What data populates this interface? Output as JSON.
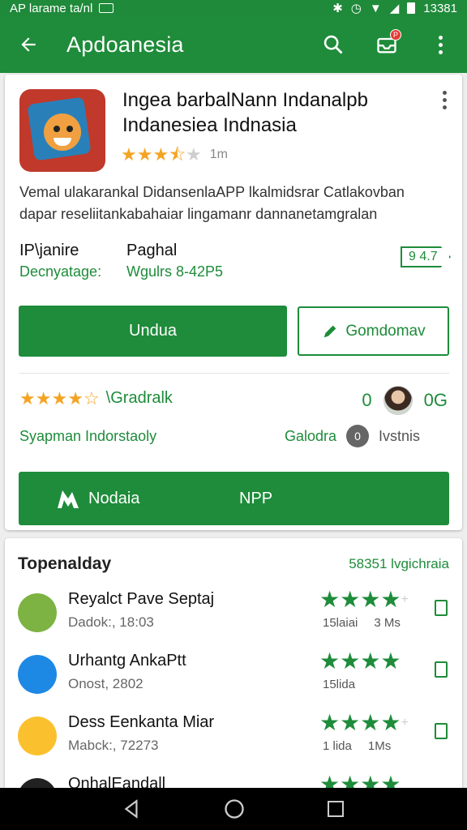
{
  "status_bar": {
    "left_text": "AP larame ta/nl",
    "time": "13381"
  },
  "app_bar": {
    "title": "Apdoanesia",
    "notif_count": "P"
  },
  "app": {
    "title_line1": "Ingea barbalNann Indanalpb",
    "title_line2": "Indanesiea Indnasia",
    "rating": 3.5,
    "rating_count": "1m",
    "description_line1": "Vemal ulakarankal DidansenlaAPP lkalmidsrar Catlakovban",
    "description_line2": "dapar reseliitankabahaiar lingamanr dannanetamgralan",
    "meta1_key": "IP\\janire",
    "meta1_value": "Decnyatage:",
    "meta2_key": "Paghal",
    "meta2_value": "Wgulrs 8-42P5",
    "tag": "9 4.7"
  },
  "buttons": {
    "install": "Undua",
    "secondary": "Gomdomav",
    "wide_left": "Nodaia",
    "wide_right": "NPP"
  },
  "sub_rating": {
    "stars": 4.5,
    "label": "\\Gradralk",
    "right_a": "0",
    "right_b": "0G"
  },
  "developer": {
    "left": "Syapman Indorstaoly",
    "right_green": "Galodra",
    "right_icon": "0",
    "right_gray": "Ivstnis"
  },
  "list": {
    "heading": "Topenalday",
    "more": "58351 lvgichraia",
    "rows": [
      {
        "name": "Reyalct Pave Septaj",
        "sub": "Dadok:, 18:03",
        "stat1": "15laiai",
        "stat2": "3 Ms",
        "icon_color": "#7cb342"
      },
      {
        "name": "Urhantg AnkaPtt",
        "sub": "Onost, 2802",
        "stat1": "15lida",
        "stat2": "",
        "icon_color": "#1e88e5"
      },
      {
        "name": "Dess Eenkanta Miar",
        "sub": "Mabck:, 72273",
        "stat1": "1 lida",
        "stat2": "1Ms",
        "icon_color": "#fbc02d"
      },
      {
        "name": "OnhalEandall",
        "sub": "",
        "stat1": "",
        "stat2": "",
        "icon_color": "#212121"
      }
    ]
  },
  "colors": {
    "primary": "#1e8c3a",
    "star": "#f4a423"
  }
}
